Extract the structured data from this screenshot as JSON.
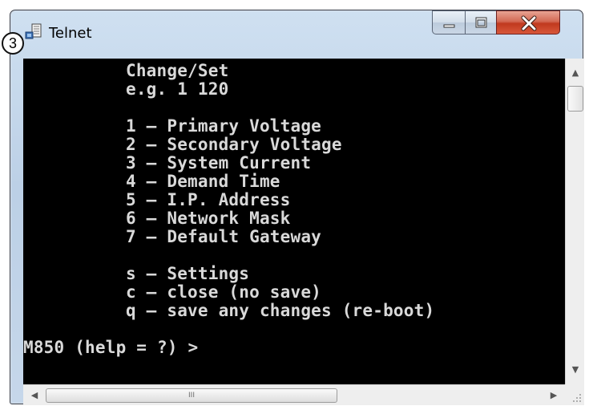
{
  "window": {
    "title": "Telnet",
    "callout_number": "3",
    "icons": {
      "app": "telnet-terminal-icon",
      "minimize": "minimize-icon",
      "maximize": "maximize-icon",
      "close": "close-icon"
    },
    "colors": {
      "close_button": "#c8452b",
      "console_bg": "#000000",
      "console_text": "#d9d9d9"
    }
  },
  "console": {
    "lines": [
      {
        "text": "Change/Set",
        "col": 10,
        "row": 0
      },
      {
        "text": "e.g. 1 120",
        "col": 10,
        "row": 1
      },
      {
        "text": "1 – Primary Voltage",
        "col": 10,
        "row": 3
      },
      {
        "text": "2 – Secondary Voltage",
        "col": 10,
        "row": 4
      },
      {
        "text": "3 – System Current",
        "col": 10,
        "row": 5
      },
      {
        "text": "4 – Demand Time",
        "col": 10,
        "row": 6
      },
      {
        "text": "5 – I.P. Address",
        "col": 10,
        "row": 7
      },
      {
        "text": "6 – Network Mask",
        "col": 10,
        "row": 8
      },
      {
        "text": "7 – Default Gateway",
        "col": 10,
        "row": 9
      },
      {
        "text": "s – Settings",
        "col": 10,
        "row": 11
      },
      {
        "text": "c – close (no save)",
        "col": 10,
        "row": 12
      },
      {
        "text": "q – save any changes (re-boot)",
        "col": 10,
        "row": 13
      },
      {
        "text": "M850 (help = ?) >",
        "col": 0,
        "row": 15
      }
    ]
  },
  "scrollbars": {
    "vertical": {
      "up_arrow": "▲",
      "down_arrow": "▼"
    },
    "horizontal": {
      "left_arrow": "◀",
      "right_arrow": "▶",
      "grip": "III"
    }
  }
}
